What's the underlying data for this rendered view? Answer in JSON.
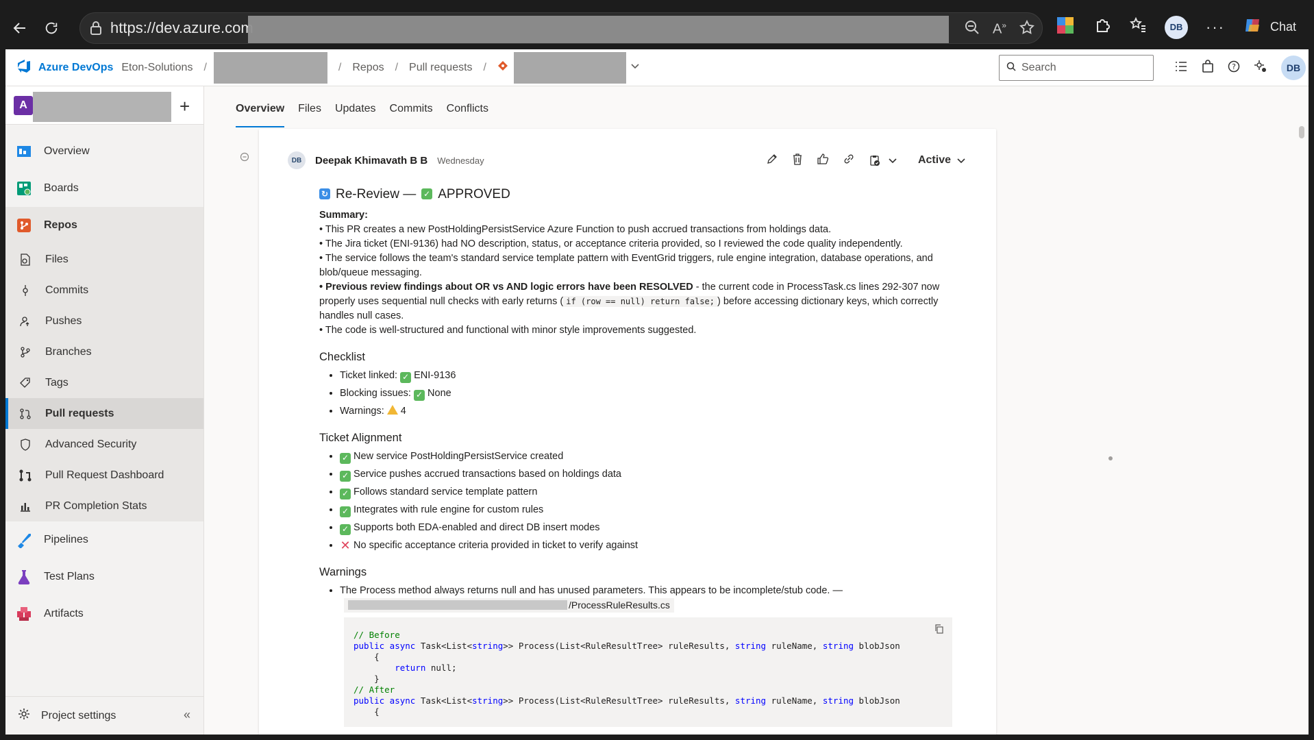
{
  "browser": {
    "url": "https://dev.azure.com",
    "copilot_label": "Chat",
    "profile_initials": "DB"
  },
  "topnav": {
    "brand": "Azure DevOps",
    "org": "Eton-Solutions",
    "repos": "Repos",
    "pull_requests": "Pull requests",
    "search_placeholder": "Search",
    "user_initials": "DB"
  },
  "sidebar": {
    "items": [
      {
        "label": "Overview"
      },
      {
        "label": "Boards"
      },
      {
        "label": "Repos"
      },
      {
        "label": "Files"
      },
      {
        "label": "Commits"
      },
      {
        "label": "Pushes"
      },
      {
        "label": "Branches"
      },
      {
        "label": "Tags"
      },
      {
        "label": "Pull requests"
      },
      {
        "label": "Advanced Security"
      },
      {
        "label": "Pull Request Dashboard"
      },
      {
        "label": "PR Completion Stats"
      },
      {
        "label": "Pipelines"
      },
      {
        "label": "Test Plans"
      },
      {
        "label": "Artifacts"
      }
    ],
    "project_initial": "A",
    "footer": "Project settings"
  },
  "tabs": [
    "Overview",
    "Files",
    "Updates",
    "Commits",
    "Conflicts"
  ],
  "comment": {
    "author_initials": "DB",
    "author": "Deepak Khimavath B B",
    "date": "Wednesday",
    "status": "Active",
    "title_prefix": "Re-Review —",
    "title_status": "APPROVED",
    "summary_heading": "Summary:",
    "summary": [
      "• This PR creates a new PostHoldingPersistService Azure Function to push accrued transactions from holdings data.",
      "• The Jira ticket (ENI-9136) had NO description, status, or acceptance criteria provided, so I reviewed the code quality independently.",
      "• The service follows the team's standard service template pattern with EventGrid triggers, rule engine integration, database operations, and blob/queue messaging."
    ],
    "summary_bold": "• Previous review findings about OR vs AND logic errors have been RESOLVED",
    "summary_bold_rest": " - the current code in ProcessTask.cs lines 292-307 now properly uses sequential null checks with early returns (",
    "summary_code": "if (row == null) return false;",
    "summary_bold_end": ") before accessing dictionary keys, which correctly handles null cases.",
    "summary_last": "• The code is well-structured and functional with minor style improvements suggested.",
    "checklist_heading": "Checklist",
    "checklist": [
      {
        "label": "Ticket linked:",
        "value": "ENI-9136",
        "icon": "check"
      },
      {
        "label": "Blocking issues:",
        "value": "None",
        "icon": "check"
      },
      {
        "label": "Warnings:",
        "value": "4",
        "icon": "warning"
      }
    ],
    "alignment_heading": "Ticket Alignment",
    "alignment": [
      {
        "text": "New service PostHoldingPersistService created",
        "icon": "check"
      },
      {
        "text": "Service pushes accrued transactions based on holdings data",
        "icon": "check"
      },
      {
        "text": "Follows standard service template pattern",
        "icon": "check"
      },
      {
        "text": "Integrates with rule engine for custom rules",
        "icon": "check"
      },
      {
        "text": "Supports both EDA-enabled and direct DB insert modes",
        "icon": "check"
      },
      {
        "text": "No specific acceptance criteria provided in ticket to verify against",
        "icon": "cross"
      }
    ],
    "warnings_heading": "Warnings",
    "warning_1": "The Process method always returns null and has unused parameters. This appears to be incomplete/stub code. —",
    "warning_1_path": "/ProcessRuleResults.cs",
    "code": {
      "c1": "// Before",
      "l1_kw": "public async",
      "l1_a": " Task<List<",
      "l1_t": "string",
      "l1_b": ">> Process(List<RuleResultTree> ruleResults, ",
      "l1_t2": "string",
      "l1_c": " ruleName, ",
      "l1_t3": "string",
      "l1_d": " blobJson",
      "l2": "    {",
      "l3_kw": "        return",
      "l3_rest": " null;",
      "l4": "    }",
      "c2": "// After",
      "l6": "    {"
    }
  }
}
